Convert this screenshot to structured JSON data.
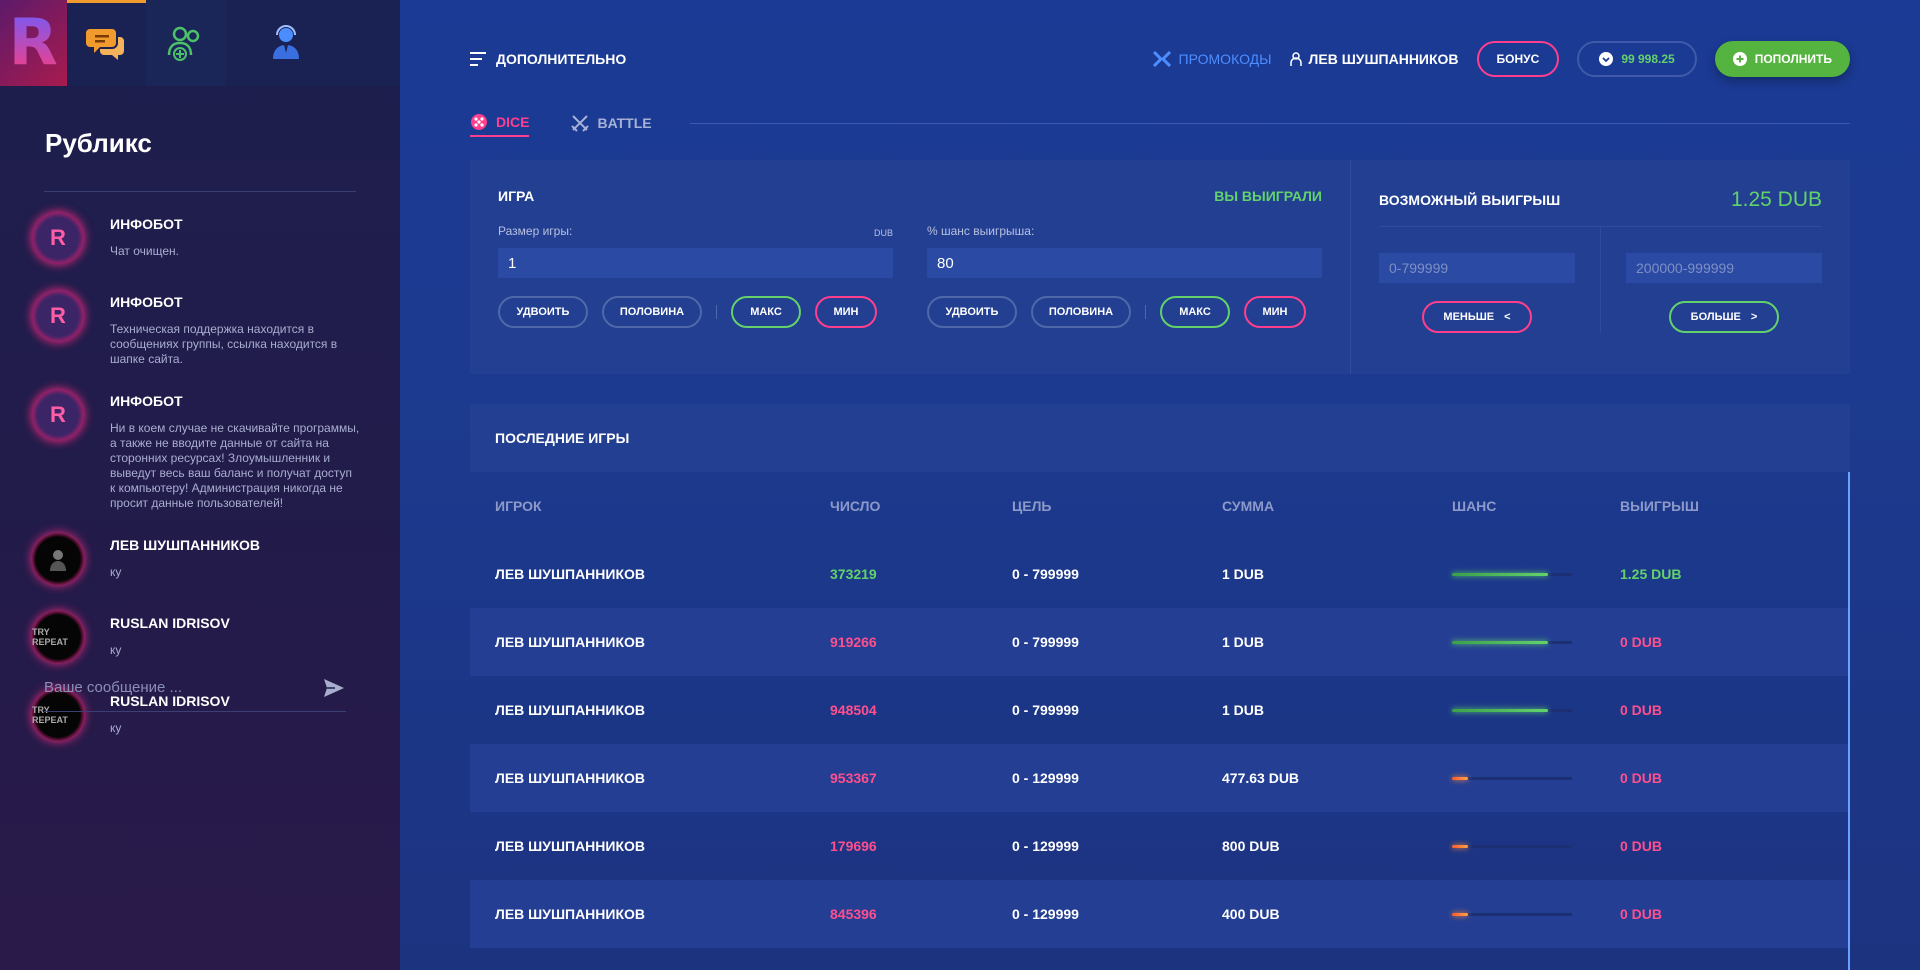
{
  "sidebar": {
    "tabs": [
      {
        "icon": "logo-r",
        "glyph": "R"
      },
      {
        "icon": "chat-icon"
      },
      {
        "icon": "add-friends-icon"
      },
      {
        "icon": "support-agent-icon"
      }
    ],
    "chat_title": "Рубликс",
    "messages": [
      {
        "author": "ИНФОБОТ",
        "text": "Чат очищен.",
        "avatar": "R"
      },
      {
        "author": "ИНФОБОТ",
        "text": "Техническая поддержка находится в сообщениях группы, ссылка находится в шапке сайта.",
        "avatar": "R"
      },
      {
        "author": "ИНФОБОТ",
        "text": "Ни в коем случае не скачивайте программы, а также не вводите данные от сайта на сторонних ресурсах! Злоумышленник и выведут весь ваш баланс и получат доступ к компьютеру! Администрация никогда не просит данные пользователей!",
        "avatar": "R"
      },
      {
        "author": "ЛЕВ ШУШПАННИКОВ",
        "text": "ку",
        "avatar": ""
      },
      {
        "author": "RUSLAN IDRISOV",
        "text": "ку",
        "avatar": "TRY REPEAT"
      },
      {
        "author": "RUSLAN IDRISOV",
        "text": "ку",
        "avatar": "TRY REPEAT"
      }
    ],
    "message_placeholder": "Ваше сообщение ..."
  },
  "topbar": {
    "menu_label": "ДОПОЛНИТЕЛЬНО",
    "promo_label": "ПРОМОКОДЫ",
    "user_name": "ЛЕВ ШУШПАННИКОВ",
    "bonus_label": "БОНУС",
    "balance": "99 998.25",
    "deposit_label": "ПОПОЛНИТЬ"
  },
  "game_tabs": [
    {
      "label": "DICE",
      "active": true
    },
    {
      "label": "BATTLE",
      "active": false
    }
  ],
  "game": {
    "title": "ИГРА",
    "status": "ВЫ ВЫИГРАЛИ",
    "bet_label": "Размер игры:",
    "bet_unit": "DUB",
    "bet_value": "1",
    "chance_label": "% шанс выигрыша:",
    "chance_value": "80",
    "double_label": "УДВОИТЬ",
    "half_label": "ПОЛОВИНА",
    "max_label": "МАКС",
    "min_label": "МИН",
    "payout_title": "ВОЗМОЖНЫЙ ВЫИГРЫШ",
    "payout_value": "1.25 DUB",
    "low_range": "0-799999",
    "high_range": "200000-999999",
    "less_label": "МЕНЬШЕ",
    "more_label": "БОЛЬШЕ",
    "less_glyph": "<",
    "more_glyph": ">"
  },
  "last_games": {
    "title": "ПОСЛЕДНИЕ ИГРЫ",
    "columns": [
      "ИГРОК",
      "ЧИСЛО",
      "ЦЕЛЬ",
      "СУММА",
      "ШАНС",
      "ВЫИГРЫШ"
    ],
    "rows": [
      {
        "player": "ЛЕВ ШУШПАННИКОВ",
        "number": "373219",
        "target": "0 - 799999",
        "sum": "1 DUB",
        "chance": 0.8,
        "win": "1.25 DUB",
        "won": true
      },
      {
        "player": "ЛЕВ ШУШПАННИКОВ",
        "number": "919266",
        "target": "0 - 799999",
        "sum": "1 DUB",
        "chance": 0.8,
        "win": "0 DUB",
        "won": false
      },
      {
        "player": "ЛЕВ ШУШПАННИКОВ",
        "number": "948504",
        "target": "0 - 799999",
        "sum": "1 DUB",
        "chance": 0.8,
        "win": "0 DUB",
        "won": false
      },
      {
        "player": "ЛЕВ ШУШПАННИКОВ",
        "number": "953367",
        "target": "0 - 129999",
        "sum": "477.63 DUB",
        "chance": 0.13,
        "win": "0 DUB",
        "won": false
      },
      {
        "player": "ЛЕВ ШУШПАННИКОВ",
        "number": "179696",
        "target": "0 - 129999",
        "sum": "800 DUB",
        "chance": 0.13,
        "win": "0 DUB",
        "won": false
      },
      {
        "player": "ЛЕВ ШУШПАННИКОВ",
        "number": "845396",
        "target": "0 - 129999",
        "sum": "400 DUB",
        "chance": 0.13,
        "win": "0 DUB",
        "won": false
      }
    ]
  },
  "colors": {
    "accent_pink": "#ff3f8e",
    "accent_green": "#63d26b",
    "promo_blue": "#4d8dff"
  }
}
